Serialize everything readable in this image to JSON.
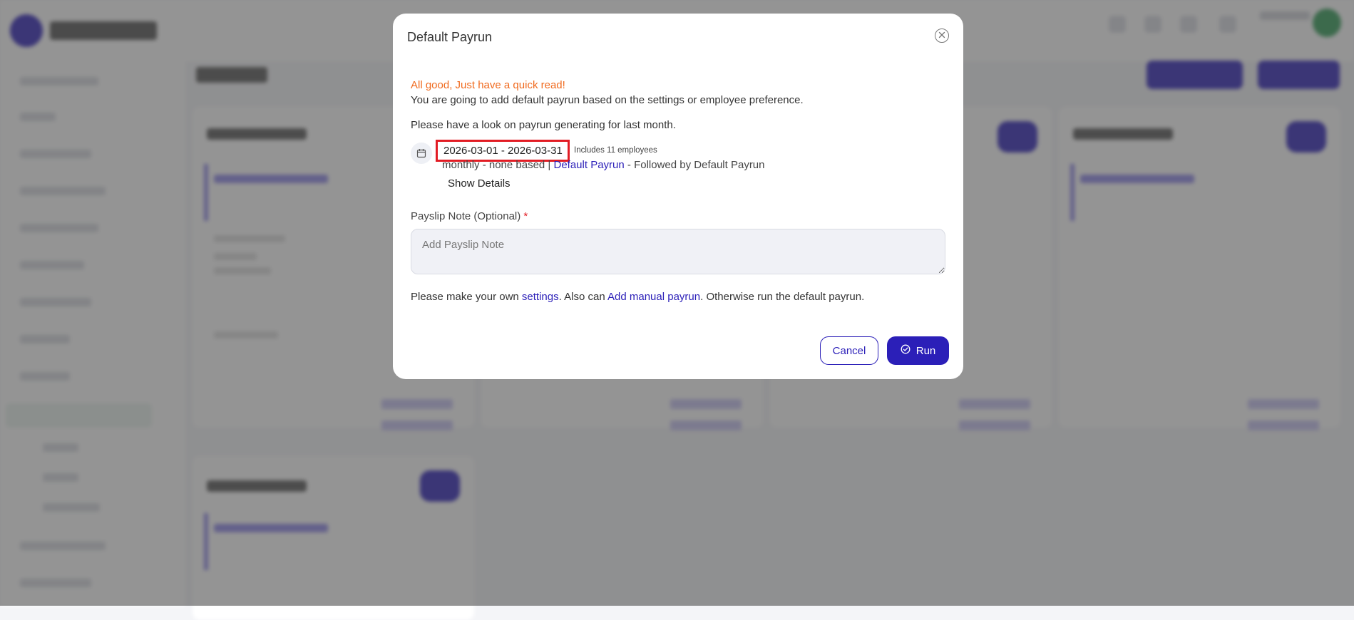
{
  "modal": {
    "title": "Default Payrun",
    "warning": "All good, Just have a quick read!",
    "intro": "You are going to add default payrun based on the settings or employee preference.",
    "look_text": "Please have a look on payrun generating for last month.",
    "date_range": "2026-03-01 - 2026-03-31",
    "employee_count": "Includes 11 employees",
    "payrun_info": {
      "prefix": "monthly - none based | ",
      "link": "Default Payrun",
      "suffix": " - Followed by Default Payrun"
    },
    "show_details": "Show Details",
    "note": {
      "label": "Payslip Note (Optional)",
      "required_mark": "*",
      "placeholder": "Add Payslip Note",
      "value": ""
    },
    "settings_line": {
      "part1": "Please make your own ",
      "settings_link": "settings",
      "part2": ". Also can ",
      "manual_link": "Add manual payrun",
      "part3": ". Otherwise run the default payrun."
    },
    "buttons": {
      "cancel": "Cancel",
      "run": "Run"
    }
  },
  "icons": {
    "close": "close-circle-icon",
    "calendar": "calendar-icon",
    "run": "check-circle-icon"
  },
  "colors": {
    "primary": "#2b1fb8",
    "warning": "#f06a1e",
    "highlight_border": "#e21c24",
    "overlay": "rgba(70,70,70,0.58)"
  }
}
